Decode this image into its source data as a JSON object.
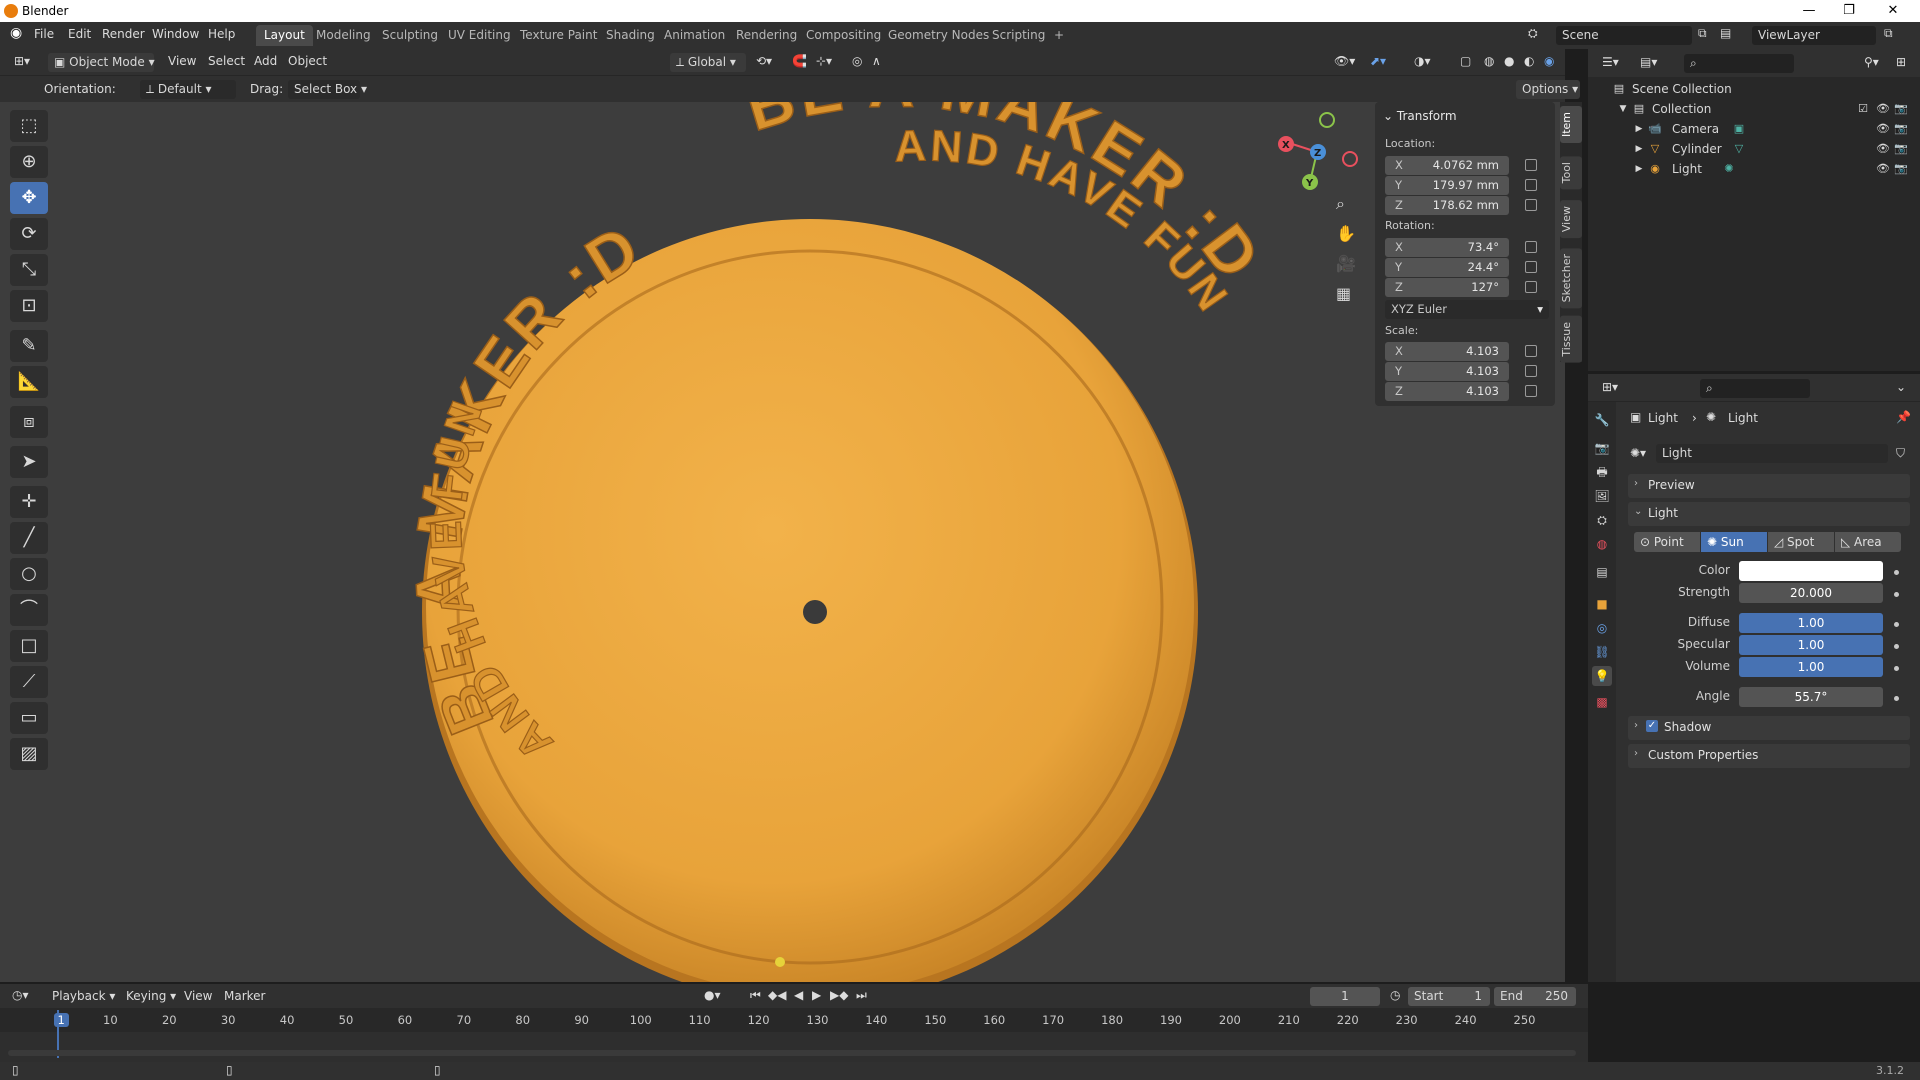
{
  "window": {
    "title": "Blender",
    "minimize": "—",
    "maximize": "❐",
    "close": "✕"
  },
  "menu": {
    "items": [
      "File",
      "Edit",
      "Render",
      "Window",
      "Help"
    ]
  },
  "workspaces": [
    "Layout",
    "Modeling",
    "Sculpting",
    "UV Editing",
    "Texture Paint",
    "Shading",
    "Animation",
    "Rendering",
    "Compositing",
    "Geometry Nodes",
    "Scripting",
    "+"
  ],
  "scene": {
    "name": "Scene",
    "view_layer": "ViewLayer"
  },
  "viewport_header": {
    "mode": "Object Mode",
    "menus": [
      "View",
      "Select",
      "Add",
      "Object"
    ],
    "transform_orientation": "Global",
    "orientation_label": "Orientation:",
    "orientation_value": "Default",
    "drag_label": "Drag:",
    "drag_value": "Select Box",
    "options": "Options"
  },
  "coin": {
    "outer_text": "BE A MAKER :D",
    "inner_text": "AND HAVE FUN",
    "color": "#e8a33a"
  },
  "npanel": {
    "section": "Transform",
    "location_label": "Location:",
    "location": [
      {
        "axis": "X",
        "value": "4.0762 mm"
      },
      {
        "axis": "Y",
        "value": "179.97 mm"
      },
      {
        "axis": "Z",
        "value": "178.62 mm"
      }
    ],
    "rotation_label": "Rotation:",
    "rotation": [
      {
        "axis": "X",
        "value": "73.4°"
      },
      {
        "axis": "Y",
        "value": "24.4°"
      },
      {
        "axis": "Z",
        "value": "127°"
      }
    ],
    "rotation_mode": "XYZ Euler",
    "scale_label": "Scale:",
    "scale": [
      {
        "axis": "X",
        "value": "4.103"
      },
      {
        "axis": "Y",
        "value": "4.103"
      },
      {
        "axis": "Z",
        "value": "4.103"
      }
    ],
    "tabs": [
      "Item",
      "Tool",
      "View",
      "Sketcher",
      "Tissue"
    ]
  },
  "outliner": {
    "root": "Scene Collection",
    "collection": "Collection",
    "objects": [
      "Camera",
      "Cylinder",
      "Light"
    ]
  },
  "properties": {
    "breadcrumb_object": "Light",
    "breadcrumb_data": "Light",
    "datablock": "Light",
    "sections": {
      "preview": "Preview",
      "light": "Light",
      "shadow": "Shadow",
      "custom": "Custom Properties"
    },
    "light_types": [
      "Point",
      "Sun",
      "Spot",
      "Area"
    ],
    "active_type": "Sun",
    "fields": {
      "color_label": "Color",
      "color": "#ffffff",
      "strength_label": "Strength",
      "strength": "20.000",
      "diffuse_label": "Diffuse",
      "diffuse": "1.00",
      "specular_label": "Specular",
      "specular": "1.00",
      "volume_label": "Volume",
      "volume": "1.00",
      "angle_label": "Angle",
      "angle": "55.7°"
    }
  },
  "timeline": {
    "menus": [
      "Playback",
      "Keying",
      "View",
      "Marker"
    ],
    "current_frame": "1",
    "start_label": "Start",
    "start": "1",
    "end_label": "End",
    "end": "250",
    "ticks": [
      "1",
      "10",
      "20",
      "30",
      "40",
      "50",
      "60",
      "70",
      "80",
      "90",
      "100",
      "110",
      "120",
      "130",
      "140",
      "150",
      "160",
      "170",
      "180",
      "190",
      "200",
      "210",
      "220",
      "230",
      "240",
      "250"
    ]
  },
  "status": {
    "version": "3.1.2"
  },
  "colors": {
    "accent": "#4772b3",
    "gizmo_x": "#e8505e",
    "gizmo_y": "#8bc34a",
    "gizmo_z": "#4a90d9"
  }
}
